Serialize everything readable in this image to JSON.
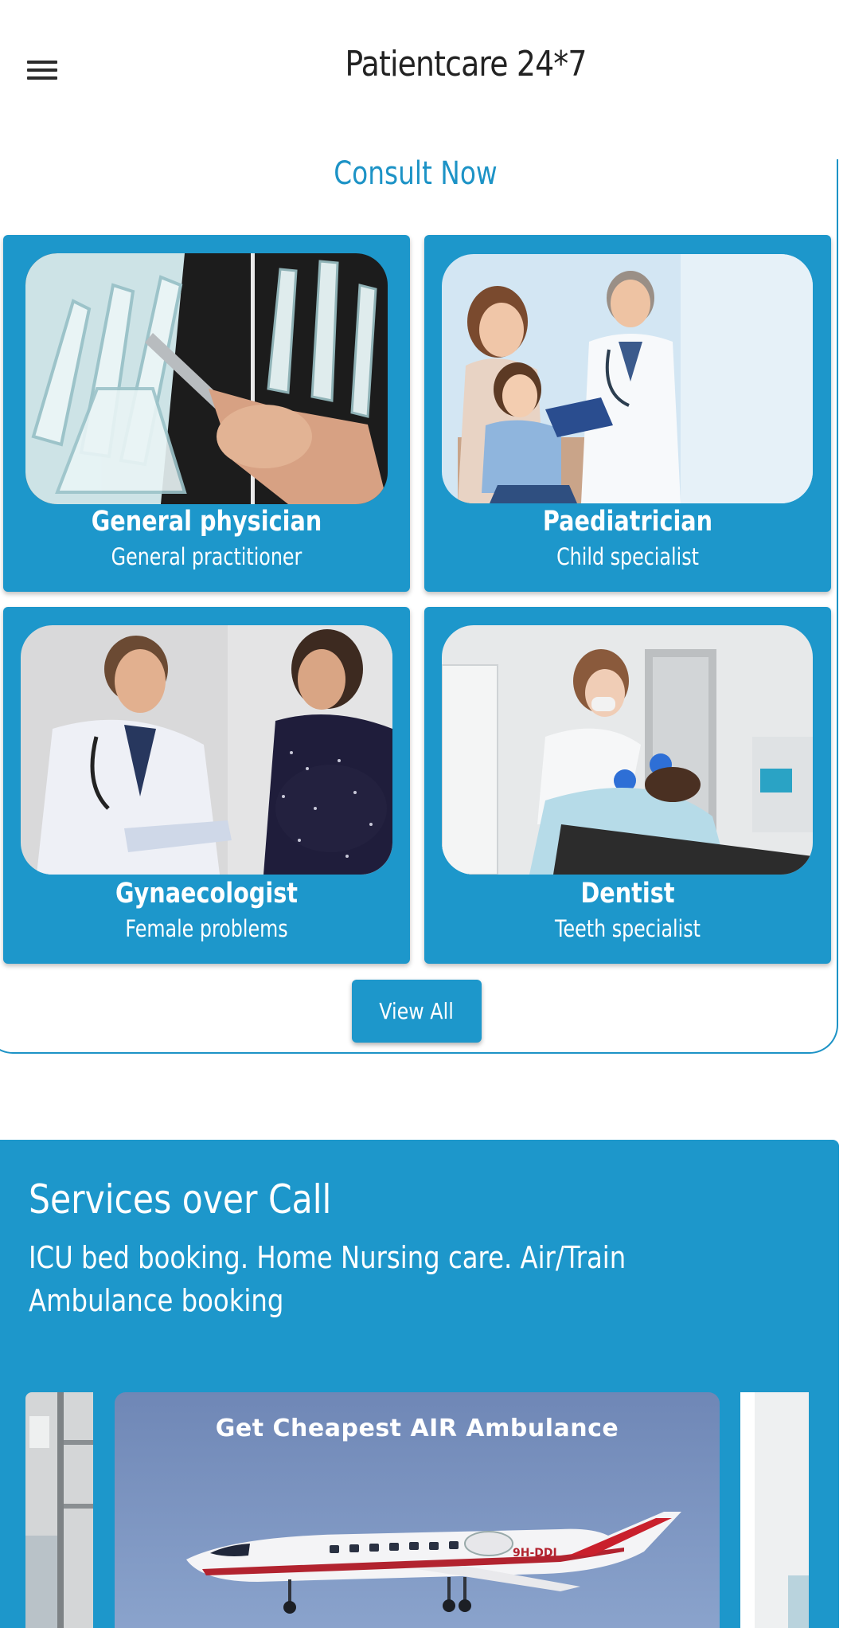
{
  "app_bar": {
    "title": "Patientcare 24*7",
    "menu_icon": "hamburger-menu-icon"
  },
  "consult": {
    "title": "Consult Now",
    "cards": [
      {
        "name": "General physician",
        "subtitle": "General practitioner",
        "image": "hand-xray-photo"
      },
      {
        "name": "Paediatrician",
        "subtitle": "Child specialist",
        "image": "doctor-with-mother-and-child-photo"
      },
      {
        "name": "Gynaecologist",
        "subtitle": "Female problems",
        "image": "doctor-with-pregnant-woman-photo"
      },
      {
        "name": "Dentist",
        "subtitle": "Teeth specialist",
        "image": "dentist-treating-patient-photo"
      }
    ],
    "view_all_label": "View All"
  },
  "services": {
    "title": "Services over Call",
    "description": "ICU bed booking. Home Nursing care. Air/Train Ambulance booking",
    "carousel": {
      "current_caption": "Get Cheapest AIR Ambulance",
      "aircraft_registration": "9H-DDJ"
    }
  },
  "colors": {
    "primary": "#1d97cb",
    "title_accent": "#1d93c6",
    "text_dark": "#222222",
    "white": "#ffffff"
  }
}
